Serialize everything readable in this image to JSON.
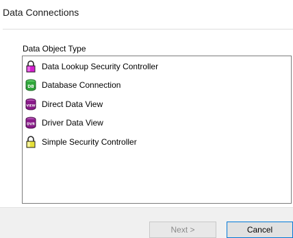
{
  "window": {
    "title": "Data Connections"
  },
  "group": {
    "label": "Data Object Type"
  },
  "list": {
    "items": [
      {
        "label": "Data Lookup Security Controller",
        "icon": "padlock-magenta-icon"
      },
      {
        "label": "Database Connection",
        "icon": "database-db-icon"
      },
      {
        "label": "Direct Data View",
        "icon": "view-icon"
      },
      {
        "label": "Driver Data View",
        "icon": "dvr-view-icon"
      },
      {
        "label": "Simple Security Controller",
        "icon": "padlock-yellow-icon"
      }
    ]
  },
  "buttons": {
    "next_label": "Next >",
    "cancel_label": "Cancel"
  },
  "icon_text": {
    "db": "DB",
    "view": "VIEW",
    "dvr": "DVR"
  },
  "colors": {
    "lock_magenta": "#d41fcf",
    "db_green": "#2fa83a",
    "view_purple": "#8a1a8a",
    "lock_yellow": "#e6e03a",
    "focus_border": "#0078d7"
  }
}
